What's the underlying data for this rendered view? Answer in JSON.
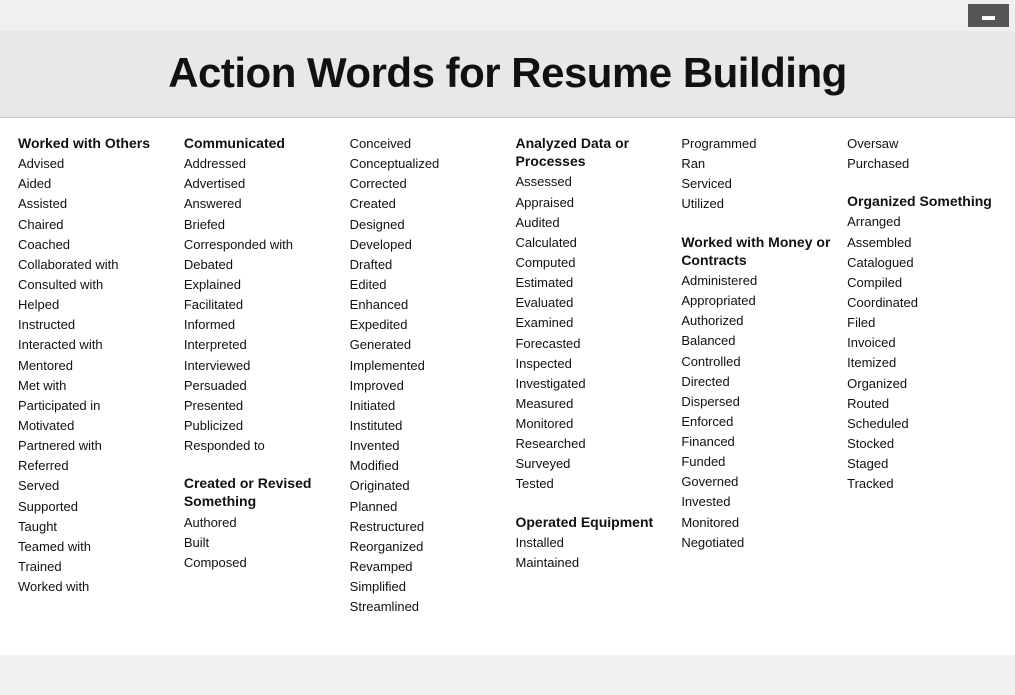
{
  "topbar": {
    "button_label": "▬"
  },
  "header": {
    "title": "Action Words for Resume Building"
  },
  "columns": [
    {
      "id": "col1",
      "sections": [
        {
          "id": "worked-with-others",
          "title": "Worked with Others",
          "words": [
            "Advised",
            "Aided",
            "Assisted",
            "Chaired",
            "Coached",
            "Collaborated with",
            "Consulted with",
            "Helped",
            "Instructed",
            "Interacted with",
            "Mentored",
            "Met with",
            "Participated in",
            "Motivated",
            "Partnered with",
            "Referred",
            "Served",
            "Supported",
            "Taught",
            "Teamed with",
            "Trained",
            "Worked with"
          ]
        }
      ]
    },
    {
      "id": "col2",
      "sections": [
        {
          "id": "communicated",
          "title": "Communicated",
          "words": [
            "Addressed",
            "Advertised",
            "Answered",
            "Briefed",
            "Corresponded with",
            "Debated",
            "Explained",
            "Facilitated",
            "Informed",
            "Interpreted",
            "Interviewed",
            "Persuaded",
            "Presented",
            "Publicized",
            "Responded to"
          ]
        },
        {
          "id": "created-revised",
          "title": "Created or Revised Something",
          "words": [
            "Authored",
            "Built",
            "Composed"
          ]
        }
      ]
    },
    {
      "id": "col3",
      "sections": [
        {
          "id": "created-cont",
          "title": "",
          "words": [
            "Conceived",
            "Conceptualized",
            "Corrected",
            "Created",
            "Designed",
            "Developed",
            "Drafted",
            "Edited",
            "Enhanced",
            "Expedited",
            "Generated",
            "Implemented",
            "Improved",
            "Initiated",
            "Instituted",
            "Invented",
            "Modified",
            "Originated",
            "Planned",
            "Restructured",
            "Reorganized",
            "Revamped",
            "Simplified",
            "Streamlined"
          ]
        }
      ]
    },
    {
      "id": "col4",
      "sections": [
        {
          "id": "analyzed-data",
          "title": "Analyzed Data or Processes",
          "words": [
            "Assessed",
            "Appraised",
            "Audited",
            "Calculated",
            "Computed",
            "Estimated",
            "Evaluated",
            "Examined",
            "Forecasted",
            "Inspected",
            "Investigated",
            "Measured",
            "Monitored",
            "Researched",
            "Surveyed",
            "Tested"
          ]
        },
        {
          "id": "operated-equipment",
          "title": "Operated Equipment",
          "words": [
            "Installed",
            "Maintained"
          ]
        }
      ]
    },
    {
      "id": "col5",
      "sections": [
        {
          "id": "operated-cont",
          "title": "",
          "words": [
            "Programmed",
            "Ran",
            "Serviced",
            "Utilized"
          ]
        },
        {
          "id": "worked-money",
          "title": "Worked with Money or Contracts",
          "words": [
            "Administered",
            "Appropriated",
            "Authorized",
            "Balanced",
            "Controlled",
            "Directed",
            "Dispersed",
            "Enforced",
            "Financed",
            "Funded",
            "Governed",
            "Invested",
            "Monitored",
            "Negotiated"
          ]
        }
      ]
    },
    {
      "id": "col6",
      "sections": [
        {
          "id": "organized-cont-top",
          "title": "",
          "words": [
            "Oversaw",
            "Purchased"
          ]
        },
        {
          "id": "organized-something",
          "title": "Organized Something",
          "words": [
            "Arranged",
            "Assembled",
            "Catalogued",
            "Compiled",
            "Coordinated",
            "Filed",
            "Invoiced",
            "Itemized",
            "Organized",
            "Routed",
            "Scheduled",
            "Stocked",
            "Staged",
            "Tracked"
          ]
        }
      ]
    }
  ]
}
